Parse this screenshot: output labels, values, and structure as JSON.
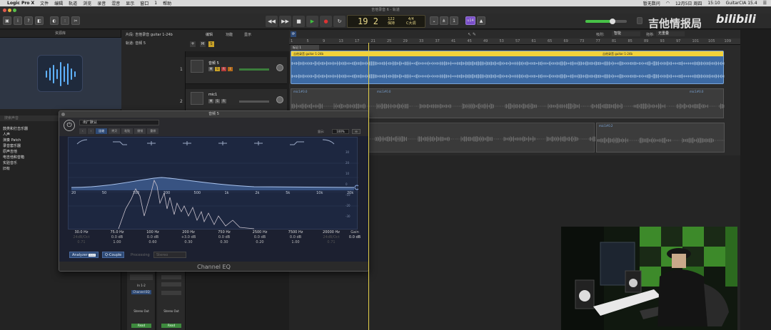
{
  "menubar": {
    "app": "Logic Pro X",
    "items": [
      "文件",
      "编辑",
      "轨道",
      "浏览",
      "录音",
      "混音",
      "显示",
      "窗口",
      "1",
      "帮助"
    ],
    "status_left": "暂无数问",
    "date": "12月5日 周四",
    "time": "15:10",
    "right_extra": "GuitarCIA 15.4"
  },
  "titlebar": {
    "title": "吉他录音 6 - 轨道"
  },
  "transport": {
    "position_bar": "19",
    "position_beat": "2",
    "tempo_value": "122",
    "tempo_label": "保持",
    "sig": "4/4",
    "key": "C大调",
    "chip": "u14"
  },
  "watermark": {
    "text": "吉他情报局",
    "logo": "bilibili"
  },
  "library": {
    "title": "资源库",
    "search_placeholder": "搜索声音",
    "items": [
      "鼓类和打击乐器",
      "人声",
      "演奏 Patch",
      "录音套乐器",
      "原声吉他",
      "电吉他和音箱",
      "实验音乐",
      "旧有"
    ]
  },
  "tracks_header": {
    "region_label": "片段: 吉他录音 guitar 1-24b",
    "track_label": "轨道: 音频 5",
    "menus": [
      "编辑",
      "功能",
      "显示"
    ]
  },
  "tracks": [
    {
      "num": "1",
      "name": "音频 5"
    },
    {
      "num": "2",
      "name": "mic1"
    }
  ],
  "arrange": {
    "ruler_marks": [
      "1",
      "5",
      "9",
      "13",
      "17",
      "21",
      "25",
      "29",
      "33",
      "37",
      "41",
      "45",
      "49",
      "53",
      "57",
      "61",
      "65",
      "69",
      "73",
      "77",
      "81",
      "85",
      "89",
      "93",
      "97",
      "101",
      "105",
      "109"
    ],
    "marker": "标记 1",
    "region1_name": "吉他录音 guitar 1-24b",
    "region1_name_right": "吉他录音 guitar 1-24b",
    "region2_name": "mic1#0.0",
    "region2_name_mid": "mic1#0.0",
    "region2_name_right": "mic1#0.0",
    "region3_name": "mic1#0.2",
    "snap_label": "吸附:",
    "snap_value": "智能",
    "drag_label": "拖移:",
    "drag_value": "无重叠"
  },
  "mixer": {
    "strip1": {
      "input": "In 1-2",
      "plugin": "Channel EQ",
      "output": "Stereo Out",
      "mode": "Read"
    },
    "strip2": {
      "output": "Stereo Out",
      "mode": "Read"
    }
  },
  "eq": {
    "window_title": "音频 5",
    "preset": "出厂默认",
    "tabs": [
      "比较",
      "拷贝",
      "粘贴",
      "撤销",
      "重做"
    ],
    "display_label": "显示:",
    "display_value": "100%",
    "freq_axis": [
      "20",
      "50",
      "100",
      "200",
      "500",
      "1k",
      "2k",
      "5k",
      "10k",
      "20k"
    ],
    "gain_axis_right": [
      "30",
      "20",
      "10",
      "0",
      "-10",
      "-20",
      "-30"
    ],
    "bands": [
      {
        "freq": "30.0 Hz",
        "gain": "24dB/Oct",
        "q": "0.71",
        "enabled": false
      },
      {
        "freq": "75.0 Hz",
        "gain": "0.0 dB",
        "q": "1.00",
        "enabled": true
      },
      {
        "freq": "100 Hz",
        "gain": "0.0 dB",
        "q": "0.60",
        "enabled": true
      },
      {
        "freq": "200 Hz",
        "gain": "+3.0 dB",
        "q": "0.30",
        "enabled": true
      },
      {
        "freq": "750 Hz",
        "gain": "0.0 dB",
        "q": "0.30",
        "enabled": true
      },
      {
        "freq": "2500 Hz",
        "gain": "0.0 dB",
        "q": "0.20",
        "enabled": true
      },
      {
        "freq": "7500 Hz",
        "gain": "0.0 dB",
        "q": "1.00",
        "enabled": true
      },
      {
        "freq": "20000 Hz",
        "gain": "24dB/Oct",
        "q": "0.71",
        "enabled": false
      }
    ],
    "gain_label": "Gain",
    "gain_value": "0.0 dB",
    "analyzer": "Analyzer",
    "analyzer_mode": "POST",
    "qcouple": "Q-Couple",
    "processing_label": "Processing",
    "processing_value": "Stereo",
    "footer": "Channel EQ"
  },
  "colors": {
    "accent_blue": "#2e4a76",
    "region_blue": "#3d6aa3",
    "region_yellow": "#f2d23a",
    "playhead": "#e4d04a"
  }
}
